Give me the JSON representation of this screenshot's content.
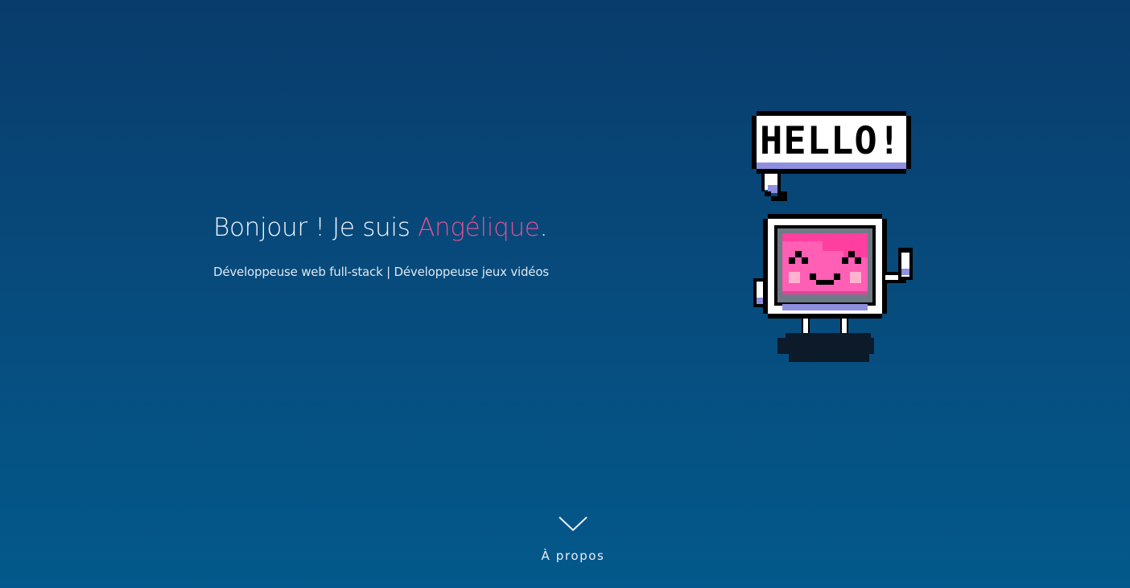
{
  "hero": {
    "greeting_prefix": "Bonjour ! Je suis ",
    "name": "Angélique",
    "greeting_suffix": ".",
    "subtitle": "Développeuse web full-stack | Développeuse jeux vidéos"
  },
  "mascot": {
    "speech_bubble_text": "HELLO!",
    "icon": "pixel-computer-mascot-icon"
  },
  "scroll": {
    "label": "À propos",
    "icon": "chevron-down-icon"
  },
  "colors": {
    "background_top": "#083c6c",
    "background_bottom": "#03598b",
    "accent": "#e24f97",
    "text": "#f2f5fa"
  }
}
